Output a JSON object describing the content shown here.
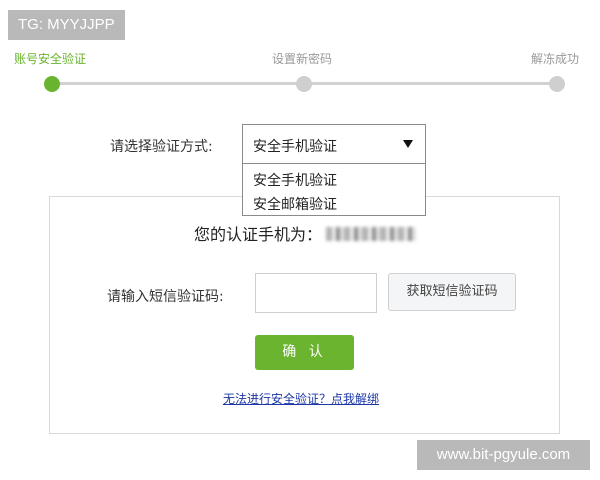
{
  "watermarks": {
    "top_left": "TG: MYYJJPP",
    "bottom_right": "www.bit-pgyule.com"
  },
  "steps": [
    {
      "label": "账号安全验证",
      "active": true
    },
    {
      "label": "设置新密码",
      "active": false
    },
    {
      "label": "解冻成功",
      "active": false
    }
  ],
  "method": {
    "label": "请选择验证方式:",
    "selected": "安全手机验证",
    "options": [
      "安全手机验证",
      "安全邮箱验证"
    ]
  },
  "verify": {
    "phone_prefix": "您的认证手机为：",
    "code_label": "请输入短信验证码:",
    "code_value": "",
    "get_code_button": "获取短信验证码",
    "confirm_button": "确 认",
    "unbind_link": "无法进行安全验证？点我解绑"
  },
  "colors": {
    "accent_green": "#6ab42f",
    "inactive_gray": "#cfcfcf",
    "link_blue": "#1d37a6",
    "tag_gray": "#b9b9b9"
  }
}
